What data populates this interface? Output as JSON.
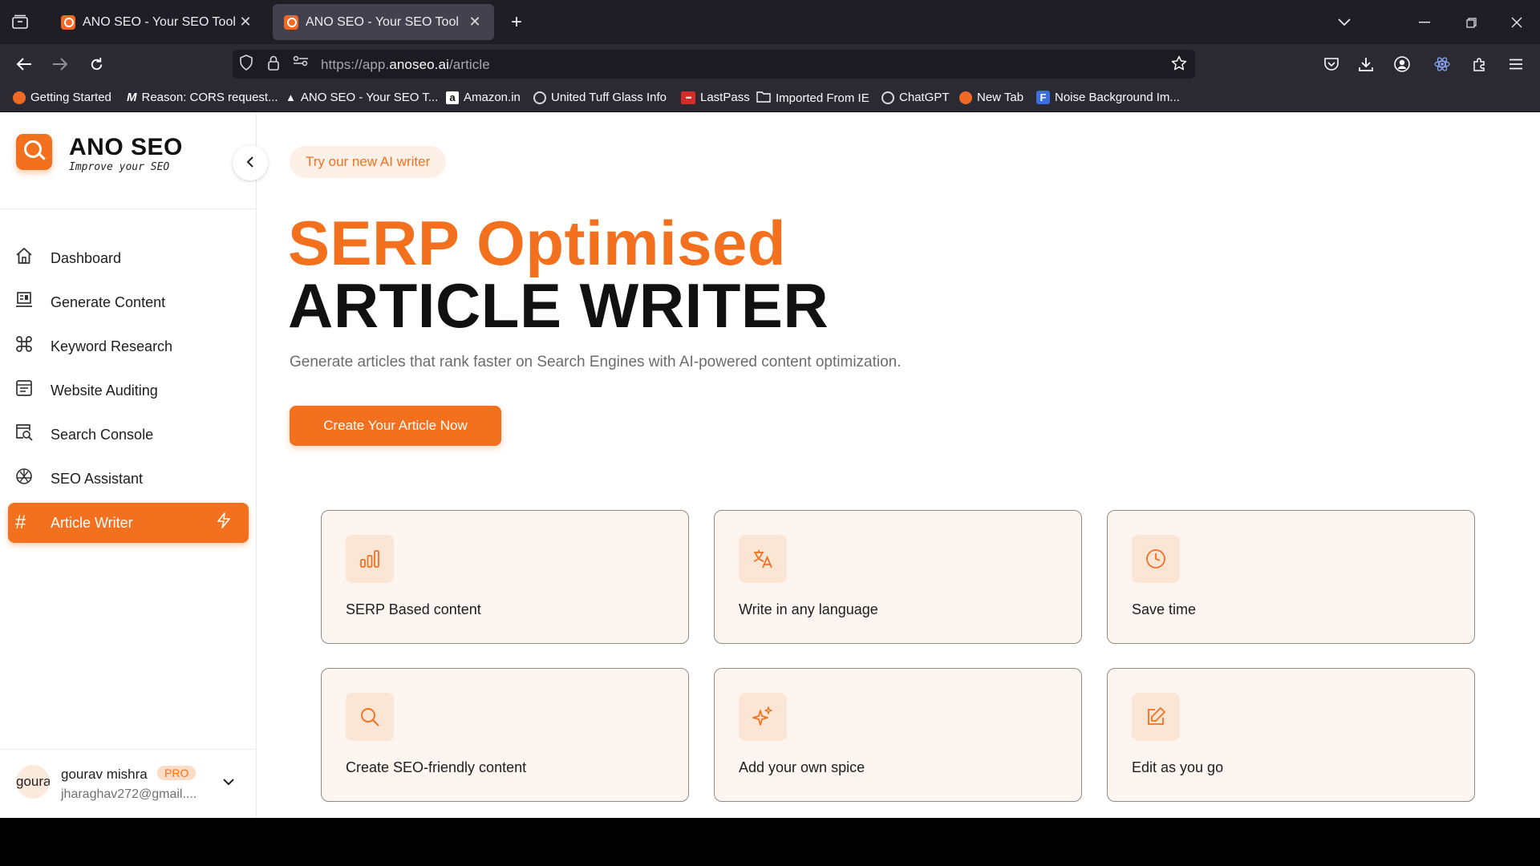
{
  "browser": {
    "tabs": [
      {
        "label": "ANO SEO - Your SEO Tool",
        "active": false
      },
      {
        "label": "ANO SEO - Your SEO Tool",
        "active": true
      }
    ],
    "url_prefix": "https://app.",
    "url_domain": "anoseo.ai",
    "url_path": "/article",
    "bookmarks": [
      {
        "label": "Getting Started",
        "color": "#f06a25"
      },
      {
        "label": "Reason: CORS request...",
        "color": "#cfcfd8"
      },
      {
        "label": "ANO SEO - Your SEO T...",
        "color": "#ffffff"
      },
      {
        "label": "Amazon.in",
        "color": "#ffffff"
      },
      {
        "label": "United Tuff Glass Info",
        "color": "#d8d8de"
      },
      {
        "label": "LastPass",
        "color": "#d32d27"
      },
      {
        "label": "Imported From IE",
        "color": "#2b2a33"
      },
      {
        "label": "ChatGPT",
        "color": "#d8d8de"
      },
      {
        "label": "New Tab",
        "color": "#f06a25"
      },
      {
        "label": "Noise Background Im...",
        "color": "#3b6fe0"
      }
    ]
  },
  "sidebar": {
    "brand_title": "ANO SEO",
    "brand_subtitle": "Improve your SEO",
    "items": [
      {
        "label": "Dashboard",
        "icon": "home-icon"
      },
      {
        "label": "Generate Content",
        "icon": "content-icon"
      },
      {
        "label": "Keyword Research",
        "icon": "keyword-icon"
      },
      {
        "label": "Website Auditing",
        "icon": "audit-icon"
      },
      {
        "label": "Search Console",
        "icon": "search-console-icon"
      },
      {
        "label": "SEO Assistant",
        "icon": "assistant-icon"
      },
      {
        "label": "Article Writer",
        "icon": "hash-icon",
        "active": true
      }
    ],
    "user": {
      "avatar_text": "goura",
      "name": "gourav mishra",
      "badge": "PRO",
      "email": "jharaghav272@gmail...."
    }
  },
  "main": {
    "pill": "Try our new AI writer",
    "headline_orange": "SERP Optimised",
    "headline_black": "ARTICLE WRITER",
    "subtitle": "Generate articles that rank faster on Search Engines with AI-powered content optimization.",
    "cta": "Create Your Article Now",
    "features": [
      {
        "label": "SERP Based content",
        "icon": "bar-chart-icon"
      },
      {
        "label": "Write in any language",
        "icon": "translate-icon"
      },
      {
        "label": "Save time",
        "icon": "clock-icon"
      },
      {
        "label": "Create SEO-friendly content",
        "icon": "search-icon"
      },
      {
        "label": "Add your own spice",
        "icon": "sparkles-icon"
      },
      {
        "label": "Edit as you go",
        "icon": "edit-icon"
      }
    ]
  },
  "colors": {
    "accent": "#f3711e",
    "accent_soft": "#fdf0e7",
    "card_bg": "#fdf5ef"
  }
}
